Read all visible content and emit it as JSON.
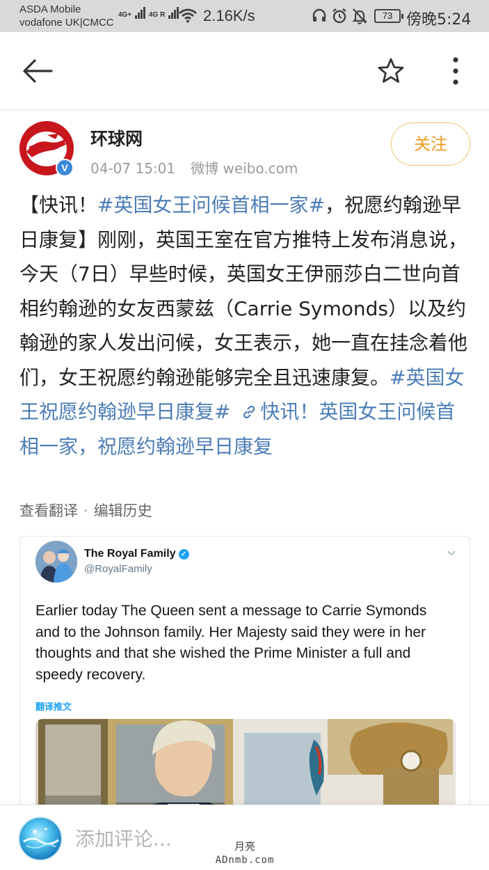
{
  "status_bar": {
    "carrier_line1": "ASDA Mobile",
    "carrier_line2": "vodafone UK|CMCC",
    "network1": "4G+",
    "network2": "4G R",
    "speed": "2.16K/s",
    "battery": "73",
    "time": "傍晚5:24"
  },
  "header": {
    "back_icon": "arrow-left-icon",
    "favorite_icon": "star-outline-icon",
    "more_icon": "vertical-dots-icon"
  },
  "post": {
    "author": "环球网",
    "verified": "V",
    "timestamp": "04-07 15:01",
    "source": "微博 weibo.com",
    "follow_label": "关注",
    "text": {
      "p1": "【快讯！",
      "hashtag1": "#英国女王问候首相一家#",
      "p2": "，祝愿约翰逊早日康复】刚刚，英国王室在官方推特上发布消息说，今天（7日）早些时候，英国女王伊丽莎白二世向首相约翰逊的女友西蒙兹（Carrie Symonds）以及约翰逊的家人发出问候，女王表示，她一直在挂念着他们，女王祝愿约翰逊能够完全且迅速康复。",
      "hashtag2": "#英国女王祝愿约翰逊早日康复#",
      "link_text": "快讯！英国女王问候首相一家，祝愿约翰逊早日康复"
    },
    "actions": {
      "translate": "查看翻译",
      "separator": "·",
      "edit_history": "编辑历史"
    }
  },
  "tweet": {
    "name": "The Royal Family",
    "handle": "@RoyalFamily",
    "text": "Earlier today The Queen sent a message to Carrie Symonds and to the Johnson family. Her Majesty said they were in her thoughts and that she wished the Prime Minister a full and speedy recovery.",
    "translate_label": "翻译推文"
  },
  "comment": {
    "placeholder": "添加评论..."
  },
  "watermark": {
    "line1": "月亮",
    "line2": "ADnmb.com"
  },
  "colors": {
    "link": "#4c7db6",
    "follow": "#f09a1e",
    "brand_red": "#c8161d",
    "twitter_blue": "#1da1f2"
  }
}
